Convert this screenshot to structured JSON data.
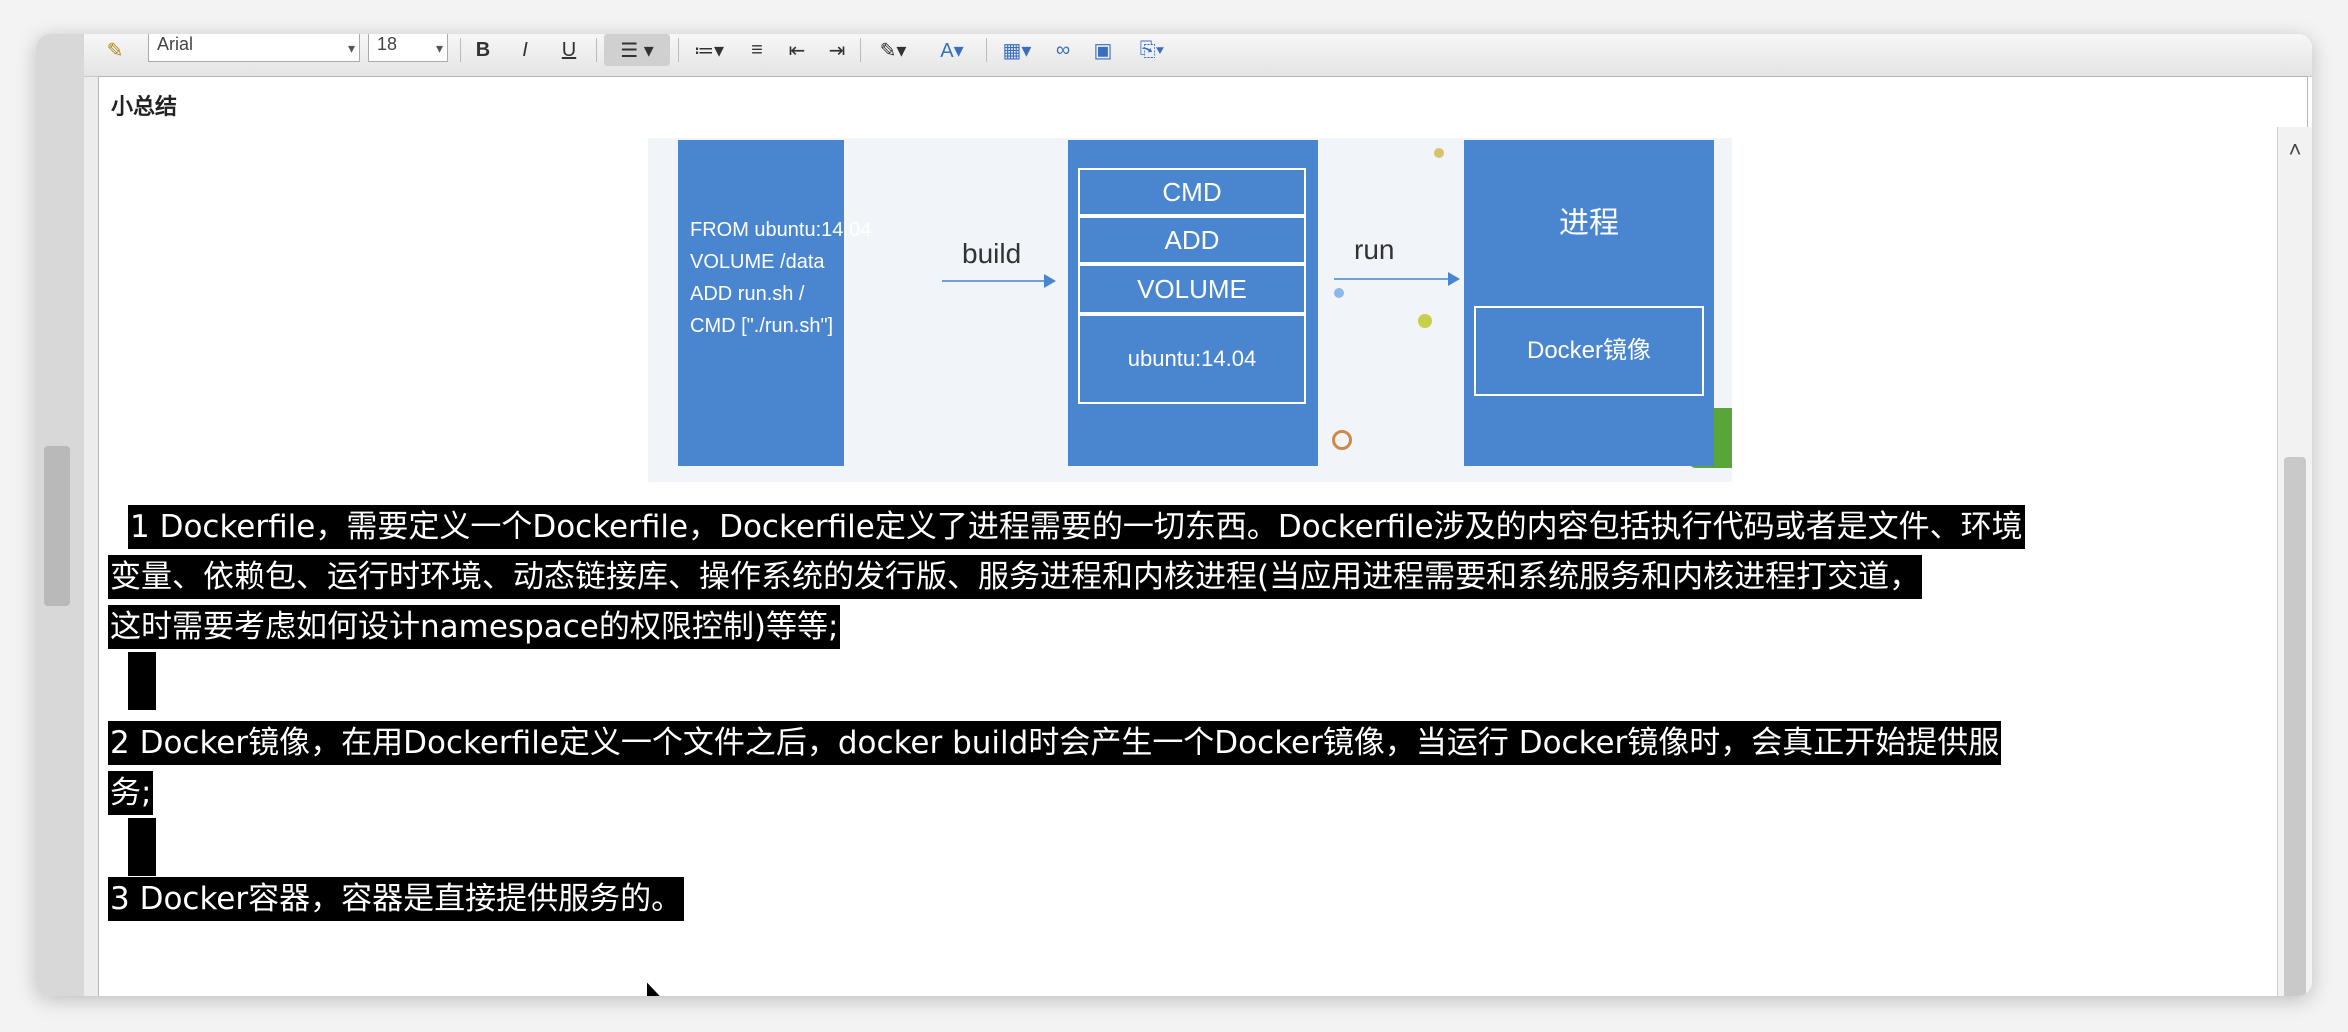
{
  "toolbar": {
    "font_name": "Arial",
    "font_size": "18",
    "bold": "B",
    "italic": "I",
    "underline": "U"
  },
  "note": {
    "title": "小总结"
  },
  "diagram": {
    "dockerfile_lines": [
      "FROM ubuntu:14.04",
      "VOLUME /data",
      "ADD run.sh /",
      "CMD [\"./run.sh\"]"
    ],
    "build_label": "build",
    "run_label": "run",
    "layers": [
      "CMD",
      "ADD",
      "VOLUME",
      "ubuntu:14.04"
    ],
    "process_label": "进程",
    "image_label": "Docker镜像"
  },
  "paragraphs": {
    "p1_lines": [
      "1 Dockerfile，需要定义一个Dockerfile，Dockerfile定义了进程需要的一切东西。Dockerfile涉及的内容包括执行代码或者是文件、环境",
      "变量、依赖包、运行时环境、动态链接库、操作系统的发行版、服务进程和内核进程(当应用进程需要和系统服务和内核进程打交道，",
      "这时需要考虑如何设计namespace的权限控制)等等;"
    ],
    "p2_lines": [
      "2 Docker镜像，在用Dockerfile定义一个文件之后，docker build时会产生一个Docker镜像，当运行 Docker镜像时，会真正开始提供服",
      "务;"
    ],
    "p3_lines": [
      "3 Docker容器，容器是直接提供服务的。"
    ]
  }
}
